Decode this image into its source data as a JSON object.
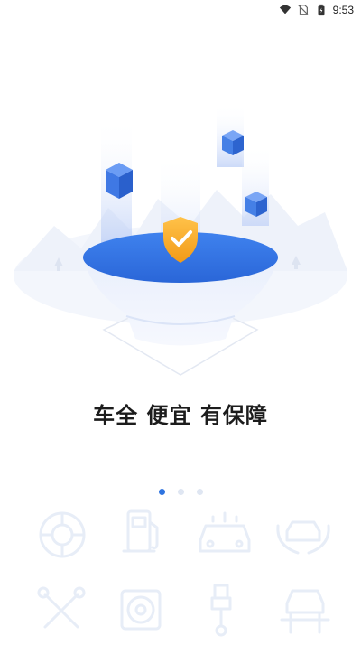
{
  "status_bar": {
    "time": "9:53",
    "icons": [
      "wifi-icon",
      "no-sim-icon",
      "battery-icon"
    ]
  },
  "onboarding": {
    "headline": "车全 便宜 有保障",
    "page_count": 3,
    "active_page": 1
  },
  "background_icons": [
    "tire-icon",
    "fuel-pump-icon",
    "car-wash-icon",
    "car-care-hands-icon",
    "tools-icon",
    "wheel-service-icon",
    "spark-plug-icon",
    "car-lift-icon"
  ],
  "colors": {
    "accent": "#2f74e0",
    "shield": "#f5a623",
    "dot_inactive": "#dfe6f2",
    "headline": "#1c1c1c"
  }
}
